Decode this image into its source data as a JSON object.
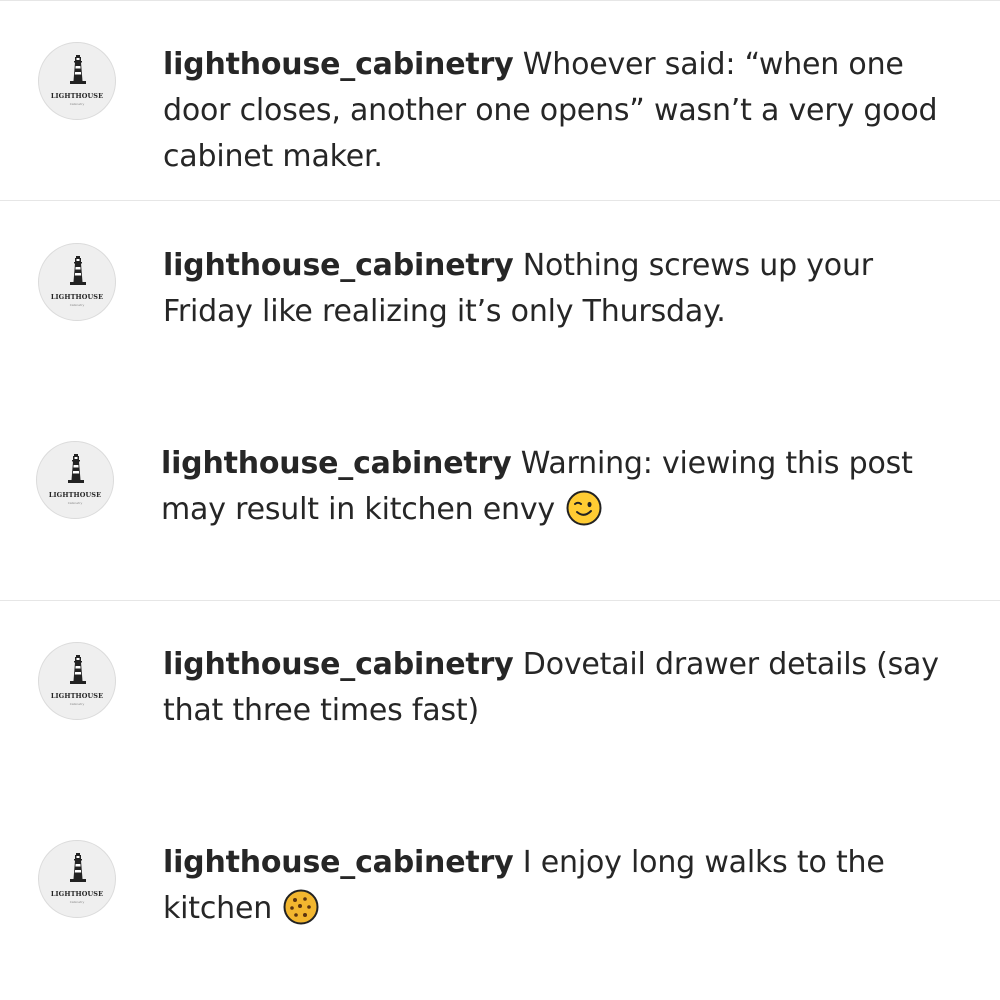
{
  "account": {
    "username": "lighthouse_cabinetry",
    "avatar_brand": "LIGHTHOUSE",
    "avatar_sub": "Cabinetry",
    "avatar_icon": "lighthouse-logo-icon"
  },
  "posts": [
    {
      "caption": "Whoever said: “when one door closes, another one opens” wasn’t a very good cabinet maker.",
      "emoji": ""
    },
    {
      "caption": "Nothing screws up your Friday like realizing it’s only Thursday.",
      "emoji": ""
    },
    {
      "caption": "Warning: viewing this post may result in kitchen envy",
      "emoji": "winking-face-icon"
    },
    {
      "caption": "Dovetail drawer details (say that three times fast)",
      "emoji": ""
    },
    {
      "caption": "I enjoy long walks to the kitchen",
      "emoji": "cookie-icon"
    }
  ]
}
